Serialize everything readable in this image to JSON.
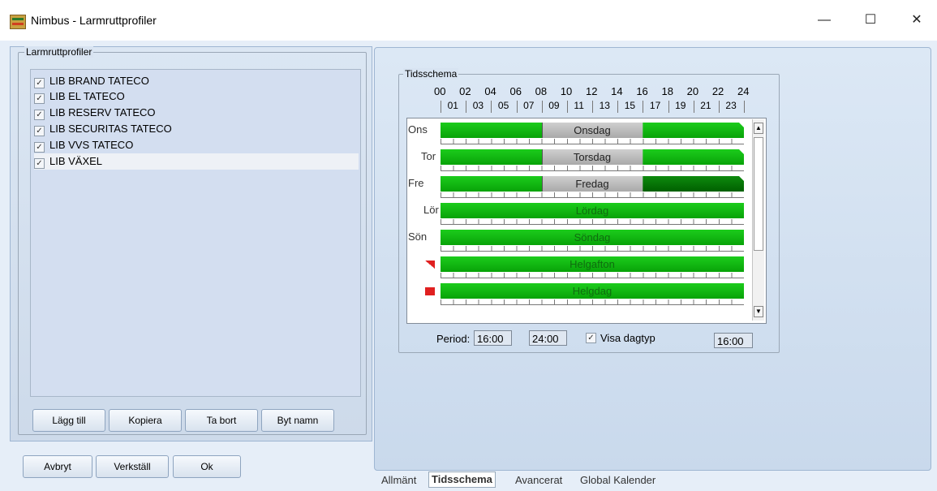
{
  "window": {
    "title": "Nimbus - Larmruttprofiler",
    "minimize": "—",
    "maximize": "☐",
    "close": "✕"
  },
  "profiles": {
    "group_title": "Larmruttprofiler",
    "items": [
      {
        "label": "LIB BRAND TATECO",
        "checked": true
      },
      {
        "label": "LIB EL TATECO",
        "checked": true
      },
      {
        "label": "LIB RESERV TATECO",
        "checked": true
      },
      {
        "label": "LIB SECURITAS TATECO",
        "checked": true
      },
      {
        "label": "LIB VVS TATECO",
        "checked": true
      },
      {
        "label": "LIB VÄXEL",
        "checked": true
      }
    ],
    "selected_index": 5,
    "buttons": {
      "add": "Lägg till",
      "copy": "Kopiera",
      "remove": "Ta bort",
      "rename": "Byt namn"
    }
  },
  "footer_buttons": {
    "cancel": "Avbryt",
    "apply": "Verkställ",
    "ok": "Ok"
  },
  "schedule": {
    "group_title": "Tidsschema",
    "hours_even": [
      "00",
      "02",
      "04",
      "06",
      "08",
      "10",
      "12",
      "14",
      "16",
      "18",
      "20",
      "22",
      "24"
    ],
    "hours_odd": [
      "01",
      "03",
      "05",
      "07",
      "09",
      "11",
      "13",
      "15",
      "17",
      "19",
      "21",
      "23"
    ],
    "rows": [
      {
        "label": "Ons",
        "day": "Onsdag"
      },
      {
        "label": "Tor",
        "day": "Torsdag"
      },
      {
        "label": "Fre",
        "day": "Fredag"
      },
      {
        "label": "Lör",
        "day": "Lördag"
      },
      {
        "label": "Sön",
        "day": "Söndag"
      },
      {
        "label": "",
        "day": "Helgafton"
      },
      {
        "label": "",
        "day": "Helgdag"
      }
    ],
    "colors": {
      "green": "#14bd14",
      "gray": "#bdbdbd",
      "dark_green": "#077a07",
      "flag_red": "#e02020"
    },
    "scroll_up": "▲",
    "scroll_down": "▼",
    "period_label": "Period:",
    "period_start": "16:00",
    "period_end": "24:00",
    "show_daytype_label": "Visa dagtyp",
    "show_daytype_checked": true,
    "current_time": "16:00"
  },
  "tabs": [
    {
      "label": "Allmänt",
      "active": false
    },
    {
      "label": "Tidsschema",
      "active": true
    },
    {
      "label": "Avancerat",
      "active": false
    },
    {
      "label": "Global Kalender",
      "active": false
    }
  ]
}
